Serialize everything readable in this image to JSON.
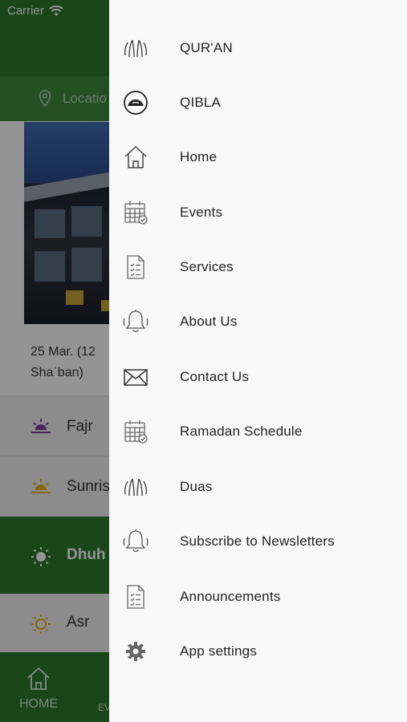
{
  "status_bar": {
    "carrier": "Carrier"
  },
  "location": {
    "placeholder": "Locatio"
  },
  "date": {
    "line1": "25 Mar. (12",
    "line2": "Shaʿban)"
  },
  "prayers": [
    {
      "name": "Fajr"
    },
    {
      "name": "Sunris"
    },
    {
      "name": "Dhuh"
    },
    {
      "name": "Asr"
    }
  ],
  "tabbar": {
    "home_label": "HOME",
    "events_label": "EV"
  },
  "menu": {
    "items": [
      {
        "label": "QUR'AN",
        "icon": "praying-hands-icon"
      },
      {
        "label": "QIBLA",
        "icon": "qibla-icon"
      },
      {
        "label": "Home",
        "icon": "home-icon"
      },
      {
        "label": "Events",
        "icon": "calendar-icon"
      },
      {
        "label": "Services",
        "icon": "document-list-icon"
      },
      {
        "label": "About Us",
        "icon": "bell-icon"
      },
      {
        "label": "Contact Us",
        "icon": "envelope-icon"
      },
      {
        "label": "Ramadan Schedule",
        "icon": "calendar-icon"
      },
      {
        "label": "Duas",
        "icon": "praying-hands-icon"
      },
      {
        "label": "Subscribe to Newsletters",
        "icon": "bell-icon"
      },
      {
        "label": "Announcements",
        "icon": "document-list-icon"
      },
      {
        "label": "App settings",
        "icon": "gear-icon"
      }
    ]
  },
  "colors": {
    "brand_green": "#2c7a2c",
    "drawer_bg": "#f8f8f8",
    "text": "#222222"
  }
}
